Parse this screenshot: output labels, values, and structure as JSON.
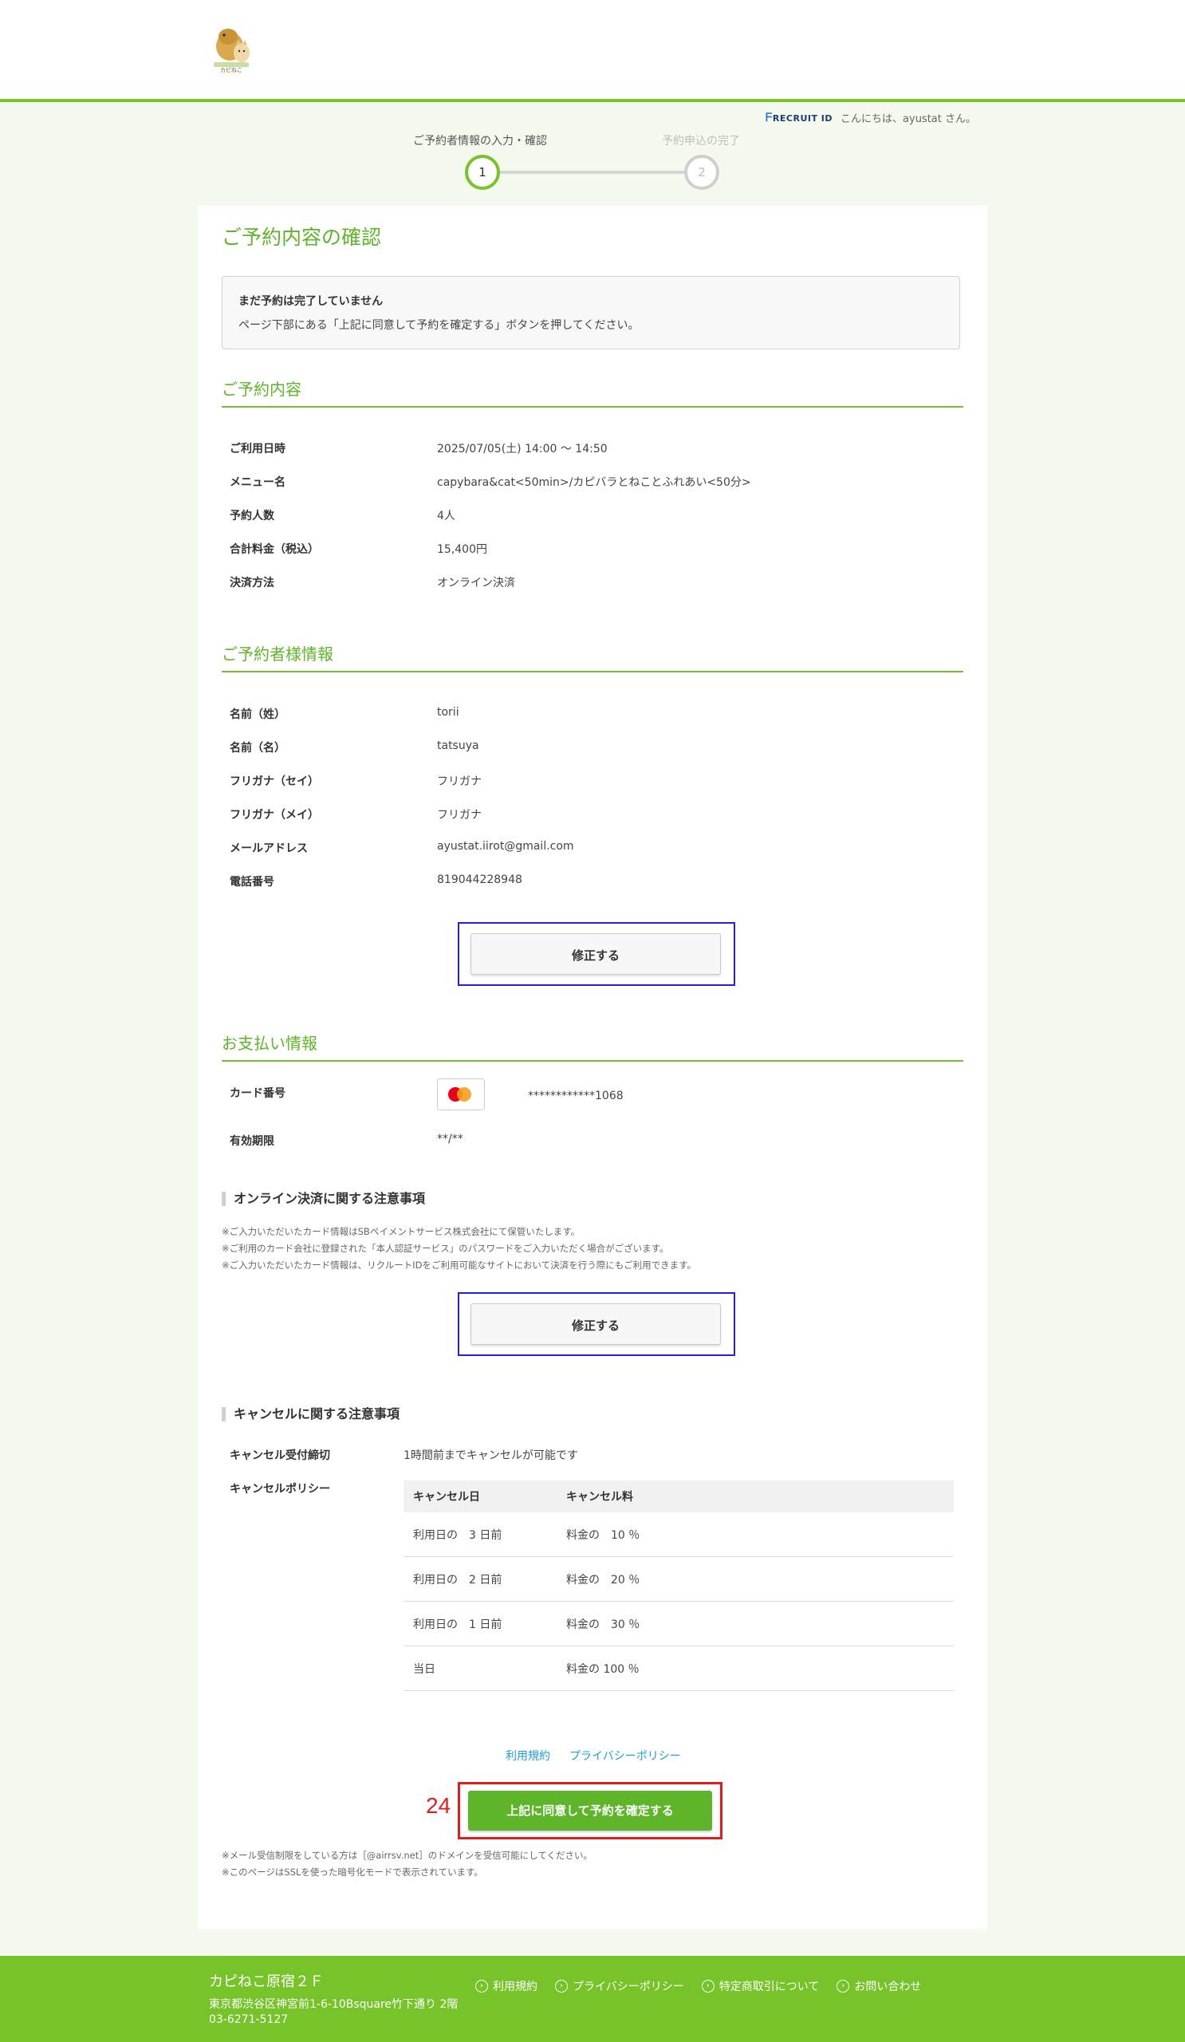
{
  "header": {
    "recruit_logo": "RECRUIT ID",
    "greeting": "こんにちは、ayustat さん。"
  },
  "steps": [
    {
      "label": "ご予約者情報の入力・確認",
      "number": "1"
    },
    {
      "label": "予約申込の完了",
      "number": "2"
    }
  ],
  "page_title": "ご予約内容の確認",
  "notice": {
    "title": "まだ予約は完了していません",
    "body": "ページ下部にある「上記に同意して予約を確定する」ボタンを押してください。"
  },
  "reservation": {
    "title": "ご予約内容",
    "rows": [
      {
        "label": "ご利用日時",
        "value": "2025/07/05(土) 14:00 〜 14:50"
      },
      {
        "label": "メニュー名",
        "value": "capybara&cat<50min>/カピバラとねことふれあい<50分>"
      },
      {
        "label": "予約人数",
        "value": "4人"
      },
      {
        "label": "合計料金（税込）",
        "value": "15,400円"
      },
      {
        "label": "決済方法",
        "value": "オンライン決済"
      }
    ]
  },
  "customer": {
    "title": "ご予約者様情報",
    "rows": [
      {
        "label": "名前（姓）",
        "value": "torii"
      },
      {
        "label": "名前（名）",
        "value": "tatsuya"
      },
      {
        "label": "フリガナ（セイ）",
        "value": "フリガナ"
      },
      {
        "label": "フリガナ（メイ）",
        "value": "フリガナ"
      },
      {
        "label": "メールアドレス",
        "value": "ayustat.iirot@gmail.com"
      },
      {
        "label": "電話番号",
        "value": "819044228948"
      }
    ],
    "edit_label": "修正する"
  },
  "payment": {
    "title": "お支払い情報",
    "card_label": "カード番号",
    "card_number": "************1068",
    "expiry_label": "有効期限",
    "expiry": "**/**",
    "notes_title": "オンライン決済に関する注意事項",
    "notes": [
      "※ご入力いただいたカード情報はSBペイメントサービス株式会社にて保管いたします。",
      "※ご利用のカード会社に登録された「本人認証サービス」のパスワードをご入力いただく場合がございます。",
      "※ご入力いただいたカード情報は、リクルートIDをご利用可能なサイトにおいて決済を行う際にもご利用できます。"
    ],
    "edit_label": "修正する"
  },
  "cancel": {
    "title": "キャンセルに関する注意事項",
    "deadline_label": "キャンセル受付締切",
    "deadline_value": "1時間前までキャンセルが可能です",
    "policy_label": "キャンセルポリシー",
    "table_headers": [
      "キャンセル日",
      "キャンセル料"
    ],
    "table_rows": [
      [
        "利用日の　3 日前",
        "料金の　10 ％"
      ],
      [
        "利用日の　2 日前",
        "料金の　20 ％"
      ],
      [
        "利用日の　1 日前",
        "料金の　30 ％"
      ],
      [
        "当日",
        "料金の 100 ％"
      ]
    ]
  },
  "links": {
    "terms": "利用規約",
    "privacy": "プライバシーポリシー"
  },
  "confirm_label": "上記に同意して予約を確定する",
  "annotation_number": "24",
  "bottom_notes": [
    "※メール受信制限をしている方は［@airrsv.net］のドメインを受信可能にしてください。",
    "※このページはSSLを使った暗号化モードで表示されています。"
  ],
  "footer": {
    "name": "カピねこ原宿２Ｆ",
    "address": "東京都渋谷区神宮前1-6-10Bsquare竹下通り 2階",
    "tel": "03-6271-5127",
    "links": [
      "利用規約",
      "プライバシーポリシー",
      "特定商取引について",
      "お問い合わせ"
    ]
  },
  "colors": {
    "accent": "#76c32a",
    "link": "#1a9fd9",
    "highlight_blue": "#2222cc",
    "highlight_red": "#e01e1e"
  }
}
